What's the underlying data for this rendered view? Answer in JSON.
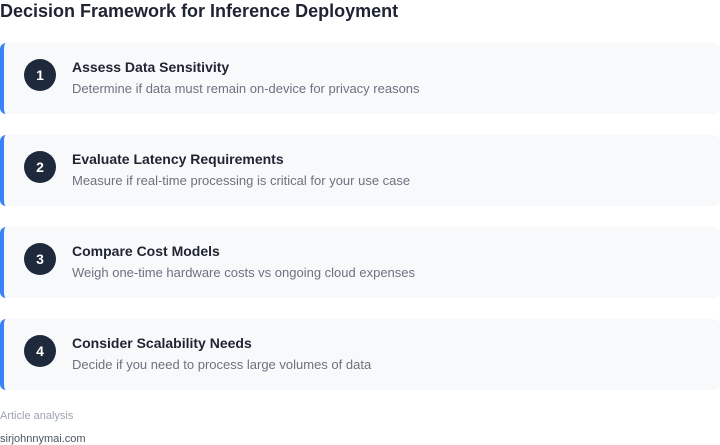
{
  "title": "Decision Framework for Inference Deployment",
  "accent_color": "#3b82f6",
  "badge_color": "#1e293b",
  "steps": [
    {
      "number": "1",
      "title": "Assess Data Sensitivity",
      "description": "Determine if data must remain on-device for privacy reasons"
    },
    {
      "number": "2",
      "title": "Evaluate Latency Requirements",
      "description": "Measure if real-time processing is critical for your use case"
    },
    {
      "number": "3",
      "title": "Compare Cost Models",
      "description": "Weigh one-time hardware costs vs ongoing cloud expenses"
    },
    {
      "number": "4",
      "title": "Consider Scalability Needs",
      "description": "Decide if you need to process large volumes of data"
    }
  ],
  "footer": {
    "label": "Article analysis",
    "site": "sirjohnnymai.com"
  }
}
